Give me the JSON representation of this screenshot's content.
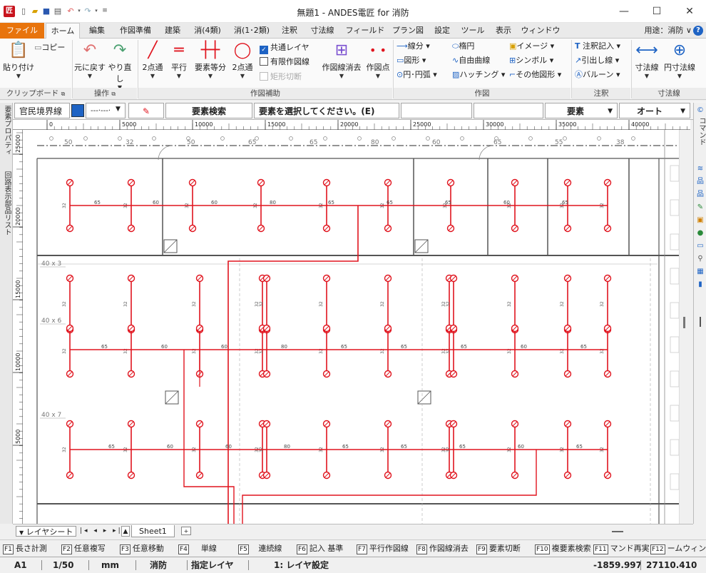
{
  "titlebar": {
    "title": "無題1 - ANDES電匠 for 消防",
    "logo": "匠",
    "minimize": "—",
    "maximize": "☐",
    "close": "✕"
  },
  "tabs": [
    "ファイル",
    "ホーム",
    "編集",
    "作図準備",
    "建築",
    "消(4類)",
    "消(1･2類)",
    "注釈",
    "寸法線",
    "フィールド",
    "プラン図",
    "設定",
    "ツール",
    "表示",
    "ウィンドウ"
  ],
  "usage": "用途：消防 ∨",
  "ribbon": {
    "clipboard": {
      "paste": "貼り付け",
      "copy": "コピー",
      "group": "クリップボード"
    },
    "ops": {
      "undo": "元に戻す",
      "redo": "やり直し",
      "group": "操作"
    },
    "assist": {
      "two_point": "2点通",
      "parallel": "平行",
      "equal_div": "要素等分",
      "two_point_circle": "2点通",
      "common_layer": "共通レイヤ",
      "limited": "有限作図線",
      "rect_cut": "矩形切断",
      "erase_lines": "作図線消去",
      "points": "作図点",
      "group": "作図補助"
    },
    "draw": {
      "segment": "線分 ▾",
      "shape": "図形 ▾",
      "circle": "円･円弧 ▾",
      "ellipse": "楕円",
      "freecurve": "自由曲線",
      "hatch": "ハッチング ▾",
      "image": "イメージ ▾",
      "symbol": "シンボル ▾",
      "other": "その他図形 ▾",
      "group": "作図"
    },
    "annot": {
      "note": "注釈記入 ▾",
      "leader": "引出し線 ▾",
      "balloon": "バルーン ▾",
      "group": "注釈"
    },
    "dim": {
      "dim": "寸法線",
      "circ": "円寸法線",
      "group": "寸法線"
    }
  },
  "propbar": {
    "layer": "官民境界線",
    "linetype": "---·---·",
    "search": "要素検索",
    "prompt": "要素を選択してください。(E)",
    "element": "要素",
    "mode": "オート"
  },
  "left_strip": {
    "a": "要素プロパティ",
    "b": "回路表示部品リスト"
  },
  "right_strip": {
    "a": "コマンド"
  },
  "ruler_top": [
    "0",
    "5000",
    "10000",
    "15000",
    "20000",
    "25000",
    "30000",
    "35000",
    "40000"
  ],
  "ruler_left": [
    "25000",
    "20000",
    "15000",
    "10000",
    "5000"
  ],
  "canvas": {
    "row_labels": [
      "40 x 3",
      "40 x 6",
      "40 x 7"
    ],
    "dims_top": [
      "50",
      "32",
      "50",
      "65",
      "65",
      "80",
      "60",
      "65",
      "55",
      "38"
    ],
    "trunk_labels": [
      "65",
      "60",
      "60",
      "80",
      "65",
      "65",
      "65",
      "60",
      "65"
    ]
  },
  "sheetbar": {
    "layer_sheet": "レイヤシート",
    "sheet": "Sheet1"
  },
  "fkeys": [
    {
      "k": "F1",
      "t": "長さ計測"
    },
    {
      "k": "F2",
      "t": "任意複写"
    },
    {
      "k": "F3",
      "t": "任意移動"
    },
    {
      "k": "F4",
      "t": "単線"
    },
    {
      "k": "F5",
      "t": "連続線"
    },
    {
      "k": "F6",
      "t": "記入 基準"
    },
    {
      "k": "F7",
      "t": "平行作図線"
    },
    {
      "k": "F8",
      "t": "作図線消去"
    },
    {
      "k": "F9",
      "t": "要素切断"
    },
    {
      "k": "F10",
      "t": "複要素検索"
    },
    {
      "k": "F11",
      "t": "マンド再実"
    },
    {
      "k": "F12",
      "t": "ームウィンド"
    }
  ],
  "status": {
    "sheet": "A1",
    "scale": "1/50",
    "unit": "mm",
    "app": "消防",
    "layer_mode": "指定レイヤ",
    "layer": "1: レイヤ設定",
    "x": "-1859.997",
    "y": "27110.410"
  },
  "colors": {
    "accent": "#e8740c",
    "blue": "#1e63c4",
    "red": "#e0141e"
  }
}
